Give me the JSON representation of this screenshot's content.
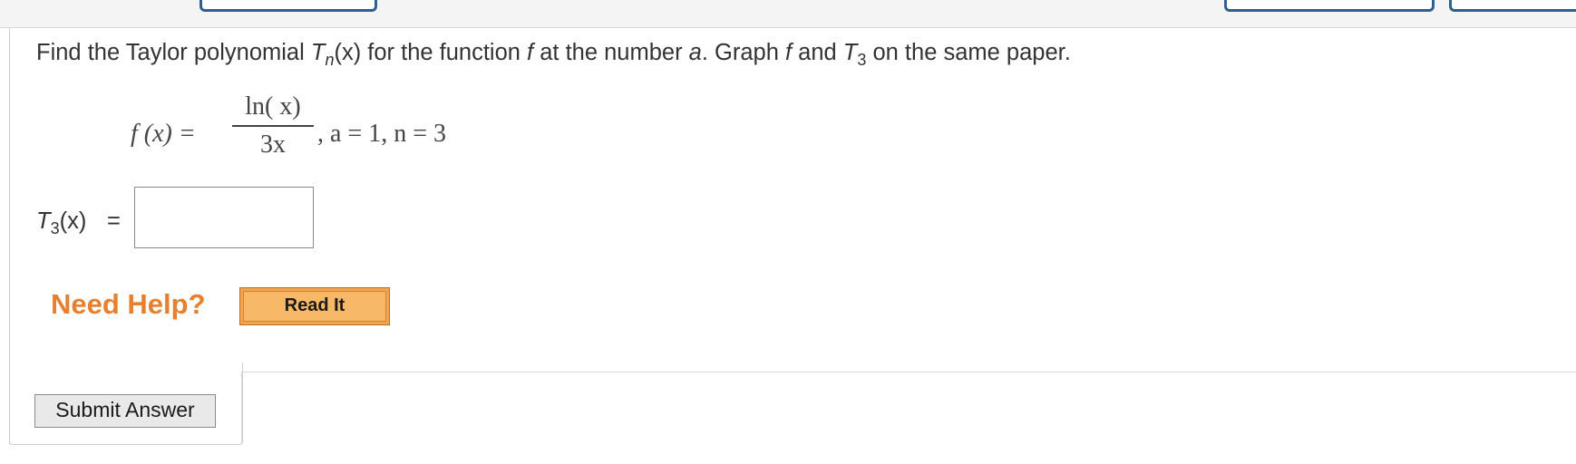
{
  "question": {
    "prefix": "Find the Taylor polynomial ",
    "tn_base": "T",
    "tn_sub": "n",
    "tn_arg": "(x)",
    "middle1": " for the function ",
    "f": "f",
    "middle2": " at the number ",
    "a": "a",
    "middle3": ". Graph ",
    "f2": "f",
    "middle4": " and ",
    "t3_base": "T",
    "t3_sub": "3",
    "suffix": " on the same paper."
  },
  "math": {
    "lhs": "f (x) =",
    "numerator": "ln( x)",
    "denominator": "3x",
    "rhs": ", a = 1, n = 3"
  },
  "answer": {
    "label_base": "T",
    "label_sub": "3",
    "label_arg": "(x)",
    "equals": "=",
    "value": ""
  },
  "help": {
    "need_help": "Need Help?",
    "read_it": "Read It"
  },
  "actions": {
    "submit": "Submit Answer"
  },
  "colors": {
    "accent_orange": "#e6802e",
    "tab_blue": "#2e5f8e"
  }
}
